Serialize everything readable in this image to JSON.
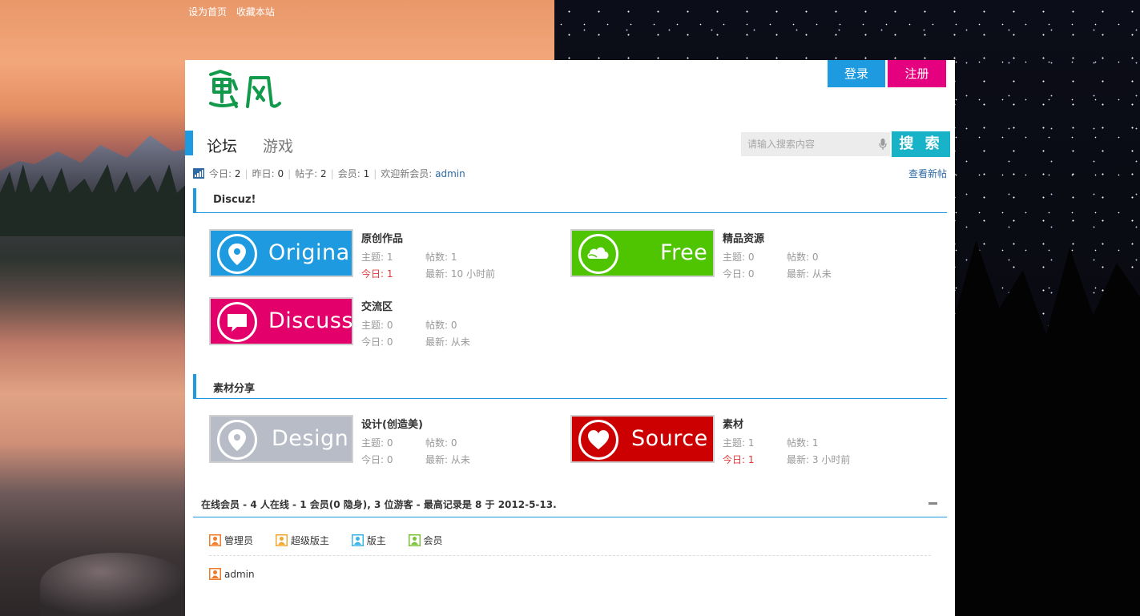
{
  "topbar": {
    "set_home": "设为首页",
    "bookmark": "收藏本站"
  },
  "header": {
    "logo_text": "魅凡",
    "login": "登录",
    "register": "注册",
    "brand_color": "#1e9be0"
  },
  "nav": {
    "items": [
      "论坛",
      "游戏"
    ]
  },
  "search": {
    "placeholder": "请输入搜索内容",
    "button": "搜 索"
  },
  "stats": {
    "today_label": "今日:",
    "today": "2",
    "yesterday_label": "昨日:",
    "yesterday": "0",
    "posts_label": "帖子:",
    "posts": "2",
    "members_label": "会员:",
    "members": "1",
    "welcome_label": "欢迎新会员:",
    "newest": "admin",
    "view_new": "查看新帖"
  },
  "categories": [
    {
      "title": "Discuz!",
      "forums": [
        {
          "tile": "Original",
          "icon": "location-pin-icon",
          "color": "#1e9be0",
          "name": "原创作品",
          "threads_label": "主题:",
          "threads": "1",
          "posts_label": "帖数:",
          "posts": "1",
          "today_label": "今日:",
          "today": "1",
          "last_label": "最新:",
          "last": "10 小时前",
          "today_hot": true
        },
        {
          "tile": "Free",
          "icon": "cloud-icon",
          "color": "#4ec500",
          "name": "精品资源",
          "threads_label": "主题:",
          "threads": "0",
          "posts_label": "帖数:",
          "posts": "0",
          "today_label": "今日:",
          "today": "0",
          "last_label": "最新:",
          "last": "从未",
          "today_hot": false
        },
        {
          "tile": "Discuss",
          "icon": "speech-bubble-icon",
          "color": "#e4006b",
          "name": "交流区",
          "threads_label": "主题:",
          "threads": "0",
          "posts_label": "帖数:",
          "posts": "0",
          "today_label": "今日:",
          "today": "0",
          "last_label": "最新:",
          "last": "从未",
          "today_hot": false
        }
      ]
    },
    {
      "title": "素材分享",
      "forums": [
        {
          "tile": "Design",
          "icon": "location-pin-icon",
          "color": "#b8bcc7",
          "name": "设计(创造美)",
          "threads_label": "主题:",
          "threads": "0",
          "posts_label": "帖数:",
          "posts": "0",
          "today_label": "今日:",
          "today": "0",
          "last_label": "最新:",
          "last": "从未",
          "today_hot": false
        },
        {
          "tile": "Source",
          "icon": "heart-icon",
          "color": "#cc0000",
          "name": "素材",
          "threads_label": "主题:",
          "threads": "1",
          "posts_label": "帖数:",
          "posts": "1",
          "today_label": "今日:",
          "today": "1",
          "last_label": "最新:",
          "last": "3 小时前",
          "today_hot": true
        }
      ]
    }
  ],
  "online": {
    "summary": "在线会员 - 4 人在线 - 1 会员(0 隐身), 3 位游客 - 最高记录是 8 于 2012-5-13.",
    "legend": [
      "管理员",
      "超级版主",
      "版主",
      "会员"
    ],
    "legend_colors": [
      "#f07c2a",
      "#f0a830",
      "#3bb5e8",
      "#7cc23a"
    ],
    "members": [
      "admin"
    ]
  }
}
